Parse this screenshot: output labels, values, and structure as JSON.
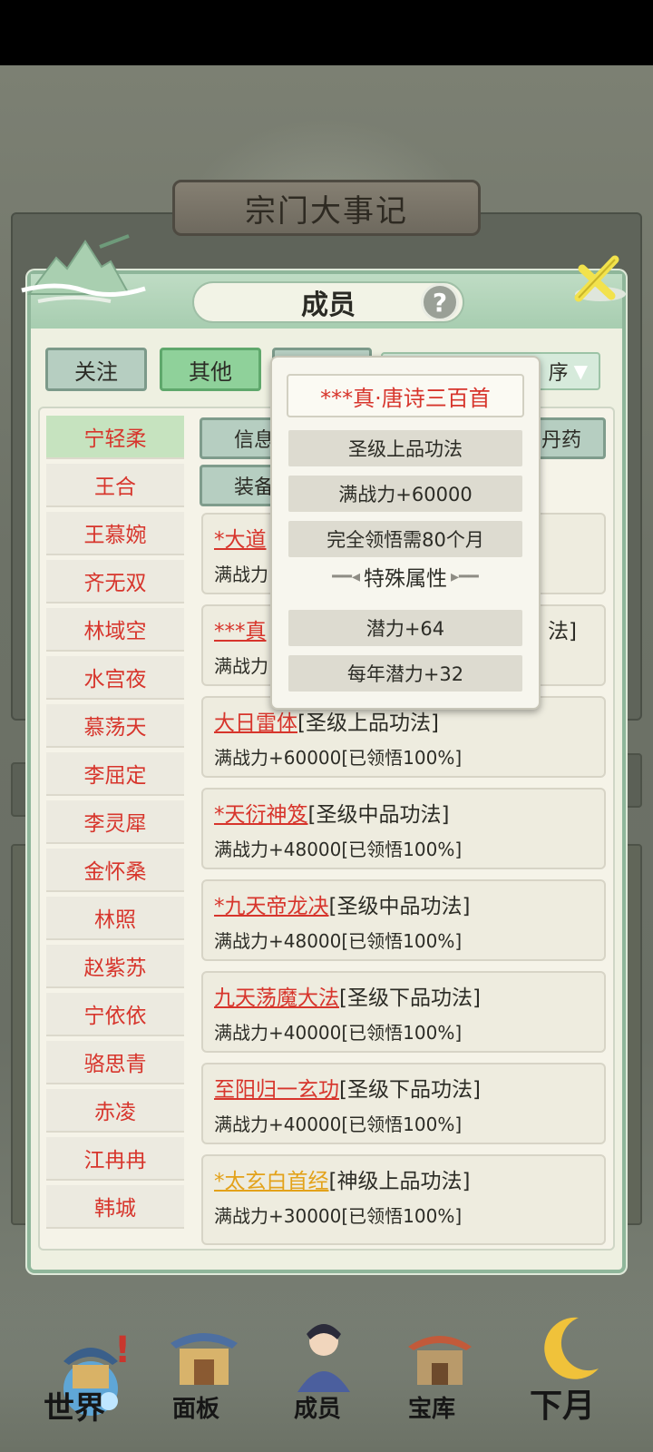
{
  "background": {
    "banner_title": "宗门大事记"
  },
  "dialog": {
    "title": "成员",
    "help_label": "?",
    "filters": {
      "follow": "关注",
      "other": "其他",
      "sort_label": "序"
    },
    "detail_tabs": {
      "info": "信息",
      "equip": "装备",
      "pill": "丹药"
    },
    "members": [
      "宁轻柔",
      "王合",
      "王慕婉",
      "齐无双",
      "林域空",
      "水宫夜",
      "慕荡天",
      "李屈定",
      "李灵犀",
      "金怀桑",
      "林照",
      "赵紫苏",
      "宁依依",
      "骆思青",
      "赤凌",
      "江冉冉",
      "韩城"
    ],
    "techniques": [
      {
        "name": "*大道",
        "grade": "",
        "stat": "满战力"
      },
      {
        "name": "***真",
        "grade": "法]",
        "stat": "满战力"
      },
      {
        "name": "大日雷体",
        "grade": "[圣级上品功法]",
        "stat": "满战力+60000[已领悟100%]",
        "color": "red"
      },
      {
        "name": "*天衍神笈",
        "grade": "[圣级中品功法]",
        "stat": "满战力+48000[已领悟100%]",
        "color": "red"
      },
      {
        "name": "*九天帝龙决",
        "grade": "[圣级中品功法]",
        "stat": "满战力+48000[已领悟100%]",
        "color": "red"
      },
      {
        "name": "九天荡魔大法",
        "grade": "[圣级下品功法]",
        "stat": "满战力+40000[已领悟100%]",
        "color": "red"
      },
      {
        "name": "至阳归一玄功",
        "grade": "[圣级下品功法]",
        "stat": "满战力+40000[已领悟100%]",
        "color": "red"
      },
      {
        "name": "*太玄白首经",
        "grade": "[神级上品功法]",
        "stat": "满战力+30000[已领悟100%]",
        "color": "gold"
      }
    ]
  },
  "popup": {
    "title": "***真·唐诗三百首",
    "grade": "圣级上品功法",
    "power": "满战力+60000",
    "comprehend": "完全领悟需80个月",
    "special_heading": "特殊属性",
    "attr1": "潜力+64",
    "attr2": "每年潜力+32"
  },
  "nav": {
    "world": "世界",
    "panel": "面板",
    "members": "成员",
    "treasury": "宝库",
    "next_month": "下月",
    "badge": "!"
  },
  "colors": {
    "name_red": "#d7352c",
    "name_gold": "#e3a21a",
    "tab_active": "#8fd19a",
    "header_green": "#a7cdb0"
  }
}
